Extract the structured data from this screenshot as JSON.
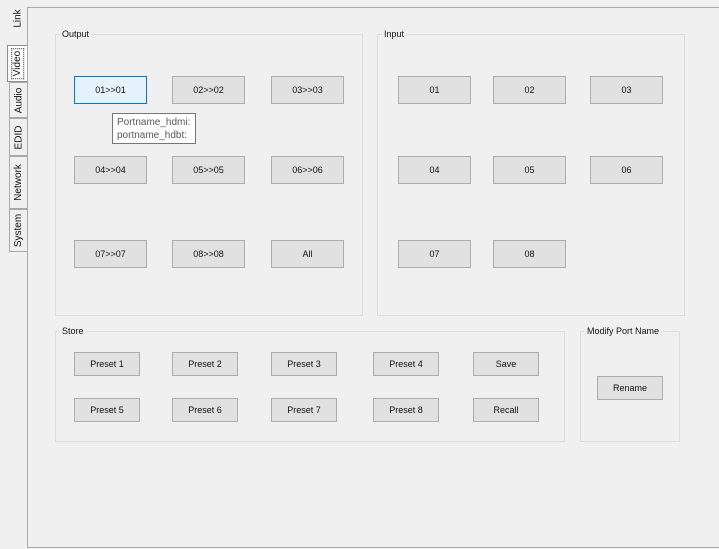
{
  "tabs": [
    {
      "label": "Link",
      "active": false
    },
    {
      "label": "Video",
      "active": true
    },
    {
      "label": "Audio",
      "active": false
    },
    {
      "label": "EDID",
      "active": false
    },
    {
      "label": "Network",
      "active": false
    },
    {
      "label": "System",
      "active": false
    }
  ],
  "output": {
    "title": "Output",
    "buttons": [
      "01>>01",
      "02>>02",
      "03>>03",
      "04>>04",
      "05>>05",
      "06>>06",
      "07>>07",
      "08>>08",
      "All"
    ]
  },
  "input": {
    "title": "Input",
    "buttons": [
      "01",
      "02",
      "03",
      "04",
      "05",
      "06",
      "07",
      "08"
    ]
  },
  "tooltip": {
    "line1": "Portname_hdmi:",
    "line2": "portname_hdbt:"
  },
  "store": {
    "title": "Store",
    "presets": [
      "Preset 1",
      "Preset 2",
      "Preset 3",
      "Preset 4",
      "Preset 5",
      "Preset 6",
      "Preset 7",
      "Preset 8"
    ],
    "save_label": "Save",
    "recall_label": "Recall"
  },
  "modify": {
    "title": "Modify Port Name",
    "rename_label": "Rename"
  }
}
